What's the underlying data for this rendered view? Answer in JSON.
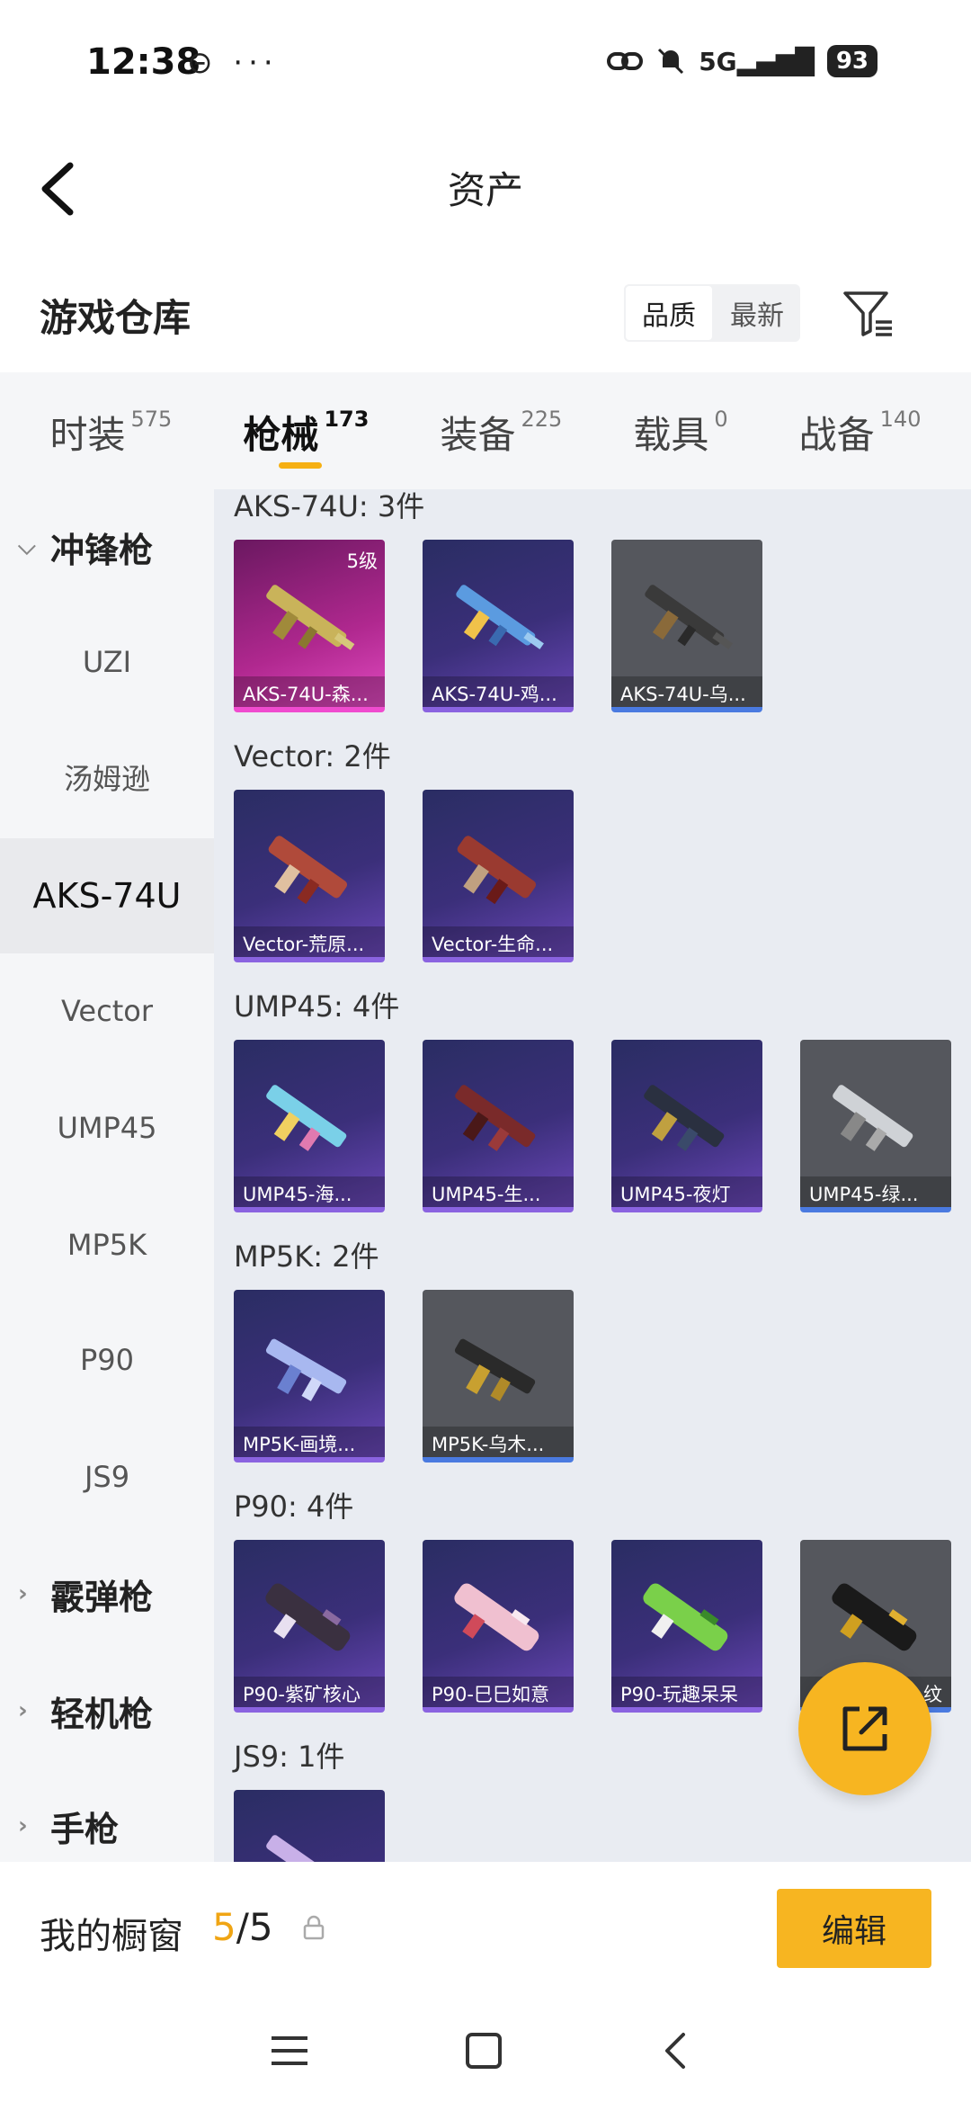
{
  "status": {
    "time": "12:38",
    "battery": "93",
    "signal": "5G"
  },
  "header": {
    "title": "资产"
  },
  "section": {
    "title": "游戏仓库",
    "sort_quality": "品质",
    "sort_latest": "最新"
  },
  "tabs": [
    {
      "label": "时装",
      "count": "575"
    },
    {
      "label": "枪械",
      "count": "173"
    },
    {
      "label": "装备",
      "count": "225"
    },
    {
      "label": "载具",
      "count": "0"
    },
    {
      "label": "战备",
      "count": "140"
    }
  ],
  "sidebar": {
    "cat_smg": "冲锋枪",
    "items": [
      "UZI",
      "汤姆逊",
      "AKS-74U",
      "Vector",
      "UMP45",
      "MP5K",
      "P90",
      "JS9"
    ],
    "cat_shotgun": "霰弹枪",
    "cat_lmg": "轻机枪",
    "cat_pistol": "手枪"
  },
  "groups": {
    "aks": {
      "title": "AKS-74U: 3件",
      "cards": [
        "AKS-74U-森...",
        "AKS-74U-鸡...",
        "AKS-74U-乌..."
      ],
      "level": "5级"
    },
    "vector": {
      "title": "Vector: 2件",
      "cards": [
        "Vector-荒原...",
        "Vector-生命..."
      ]
    },
    "ump": {
      "title": "UMP45: 4件",
      "cards": [
        "UMP45-海...",
        "UMP45-生...",
        "UMP45-夜灯",
        "UMP45-绿..."
      ]
    },
    "mp5k": {
      "title": "MP5K: 2件",
      "cards": [
        "MP5K-画境...",
        "MP5K-乌木..."
      ]
    },
    "p90": {
      "title": "P90: 4件",
      "cards": [
        "P90-紫矿核心",
        "P90-巳巳如意",
        "P90-玩趣呆呆",
        "纹"
      ]
    },
    "js9": {
      "title": "JS9: 1件"
    }
  },
  "showcase": {
    "label": "我的橱窗",
    "current": "5",
    "total": "/5",
    "edit": "编辑"
  },
  "colors": {
    "accent": "#f7b521",
    "rare_purple": "#8a63e0",
    "common_blue": "#4a7ae0",
    "legend_pink": "#f04bcf"
  }
}
